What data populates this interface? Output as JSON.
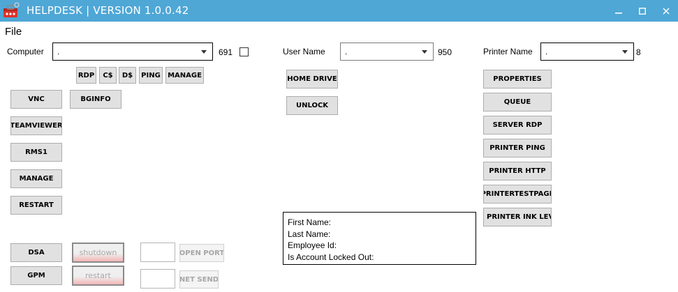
{
  "window": {
    "title": "HELPDESK | VERSION 1.0.0.42",
    "minimize_icon": "minimize-icon",
    "maximize_icon": "maximize-icon",
    "close_icon": "close-icon",
    "app_icon": "toolbox-icon",
    "accent_color": "#4fa7d6"
  },
  "menu": {
    "file_label": "File"
  },
  "computer": {
    "label": "Computer",
    "value": ".",
    "count": "691",
    "checkbox_checked": false,
    "buttons": {
      "rdp": "RDP",
      "c_share": "C$",
      "d_share": "D$",
      "ping": "PING",
      "manage": "MANAGE",
      "vnc": "VNC",
      "bginfo": "BGINFO",
      "teamviewer": "TEAMVIEWER",
      "rms1": "RMS1",
      "manage2": "MANAGE",
      "restart": "RESTART",
      "dsa": "DSA",
      "gpm": "GPM",
      "shutdown": "shutdown",
      "restart_red": "restart",
      "open_port": "OPEN PORT",
      "net_send": "NET SEND"
    },
    "port_input_value": "",
    "message_input_value": ""
  },
  "user": {
    "label": "User Name",
    "value": ".",
    "count": "950",
    "buttons": {
      "home_drive": "HOME DRIVE",
      "unlock": "UNLOCK"
    },
    "info": {
      "first_name": "First Name:",
      "last_name": "Last Name:",
      "employee_id": "Employee Id:",
      "locked_out": "Is Account Locked Out:"
    }
  },
  "printer": {
    "label": "Printer Name",
    "value": ".",
    "count": "8",
    "buttons": {
      "properties": "PROPERTIES",
      "queue": "QUEUE",
      "server_rdp": "SERVER RDP",
      "printer_ping": "PRINTER PING",
      "printer_http": "PRINTER HTTP",
      "printer_test_page": "PRINTERTESTPAGE",
      "printer_ink_level": "PRINTER INK LEVEL"
    }
  }
}
